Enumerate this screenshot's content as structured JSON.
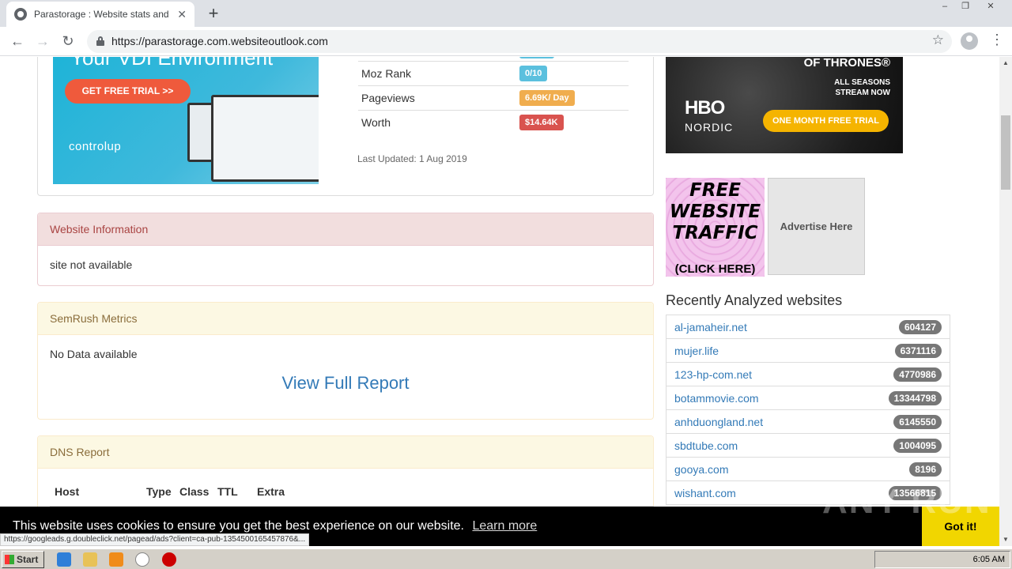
{
  "browser": {
    "tab_title": "Parastorage : Website stats and val",
    "new_tab": "+",
    "url": "https://parastorage.com.websiteoutlook.com",
    "window_controls": [
      "–",
      "❐",
      "✕"
    ]
  },
  "ad_left": {
    "headline": "Your VDI Environment",
    "cta": "GET FREE TRIAL >>",
    "logo": "controlup"
  },
  "stats": [
    {
      "label": "Moz Rank",
      "value": "0/10",
      "color": "#5bc0de"
    },
    {
      "label": "Pageviews",
      "value": "6.69K/ Day",
      "color": "#f0ad4e"
    },
    {
      "label": "Worth",
      "value": "$14.64K",
      "color": "#d9534f"
    }
  ],
  "last_updated": "Last Updated: 1 Aug 2019",
  "website_info": {
    "title": "Website Information",
    "body": "site not available"
  },
  "semrush": {
    "title": "SemRush Metrics",
    "body": "No Data available",
    "link": "View Full Report"
  },
  "dns": {
    "title": "DNS Report",
    "columns": [
      "Host",
      "Type",
      "Class",
      "TTL",
      "Extra"
    ]
  },
  "ad_hbo": {
    "title": "OF THRONES®",
    "line1": "ALL SEASONS",
    "line2": "STREAM NOW",
    "brand": "HBO",
    "region": "NORDIC",
    "cta": "ONE MONTH FREE TRIAL"
  },
  "ad_traffic": {
    "text": "FREE WEBSITE TRAFFIC",
    "cta": "(CLICK HERE)"
  },
  "ad_here": "Advertise Here",
  "recent": {
    "title": "Recently Analyzed websites",
    "items": [
      {
        "site": "al-jamaheir.net",
        "rank": "604127"
      },
      {
        "site": "mujer.life",
        "rank": "6371116"
      },
      {
        "site": "123-hp-com.net",
        "rank": "4770986"
      },
      {
        "site": "botammovie.com",
        "rank": "13344798"
      },
      {
        "site": "anhduongland.net",
        "rank": "6145550"
      },
      {
        "site": "sbdtube.com",
        "rank": "1004095"
      },
      {
        "site": "gooya.com",
        "rank": "8196"
      },
      {
        "site": "wishant.com",
        "rank": "13566815"
      }
    ]
  },
  "cookie": {
    "text": "This website uses cookies to ensure you get the best experience on our website.",
    "link": "Learn more",
    "button": "Got it!"
  },
  "watermark": "ANY RUN",
  "status_url": "https://googleads.g.doubleclick.net/pagead/ads?client=ca-pub-1354500165457876&...",
  "taskbar": {
    "start": "Start",
    "clock": "6:05 AM"
  }
}
